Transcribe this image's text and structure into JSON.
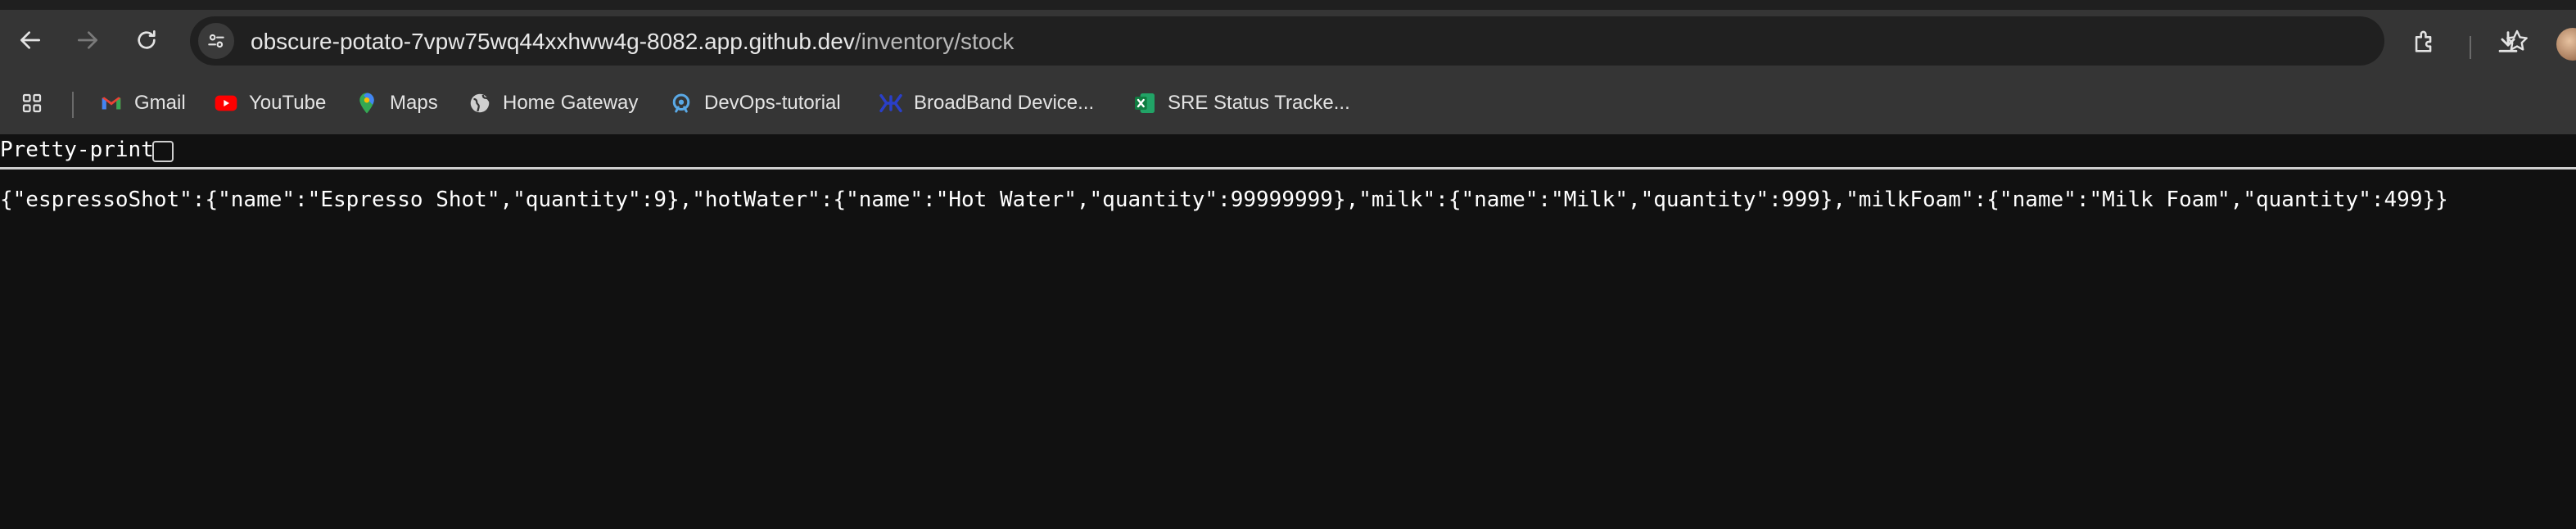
{
  "browser": {
    "url_host": "obscure-potato-7vpw75wq44xxhww4g-8082.app.github.dev",
    "url_path": "/inventory/stock",
    "nav_icons": [
      "back-icon",
      "forward-icon",
      "reload-icon"
    ],
    "toolbar_icons": [
      "star-icon",
      "extensions-icon",
      "download-icon"
    ]
  },
  "bookmarks": [
    {
      "label": "Gmail",
      "icon": "gmail-icon"
    },
    {
      "label": "YouTube",
      "icon": "youtube-icon"
    },
    {
      "label": "Maps",
      "icon": "maps-icon"
    },
    {
      "label": "Home Gateway",
      "icon": "globe-icon"
    },
    {
      "label": "DevOps-tutorial",
      "icon": "devops-icon"
    },
    {
      "label": "BroadBand Device...",
      "icon": "broadband-icon"
    },
    {
      "label": "SRE Status Tracke...",
      "icon": "excel-icon"
    }
  ],
  "page": {
    "pretty_print_label": "Pretty-print",
    "pretty_print_checked": false,
    "json_text": "{\"espressoShot\":{\"name\":\"Espresso Shot\",\"quantity\":9},\"hotWater\":{\"name\":\"Hot Water\",\"quantity\":99999999},\"milk\":{\"name\":\"Milk\",\"quantity\":999},\"milkFoam\":{\"name\":\"Milk Foam\",\"quantity\":499}}"
  },
  "colors": {
    "toolbar_bg": "#353535",
    "omnibox_bg": "#202020",
    "page_bg": "#111111",
    "text": "#ffffff"
  }
}
